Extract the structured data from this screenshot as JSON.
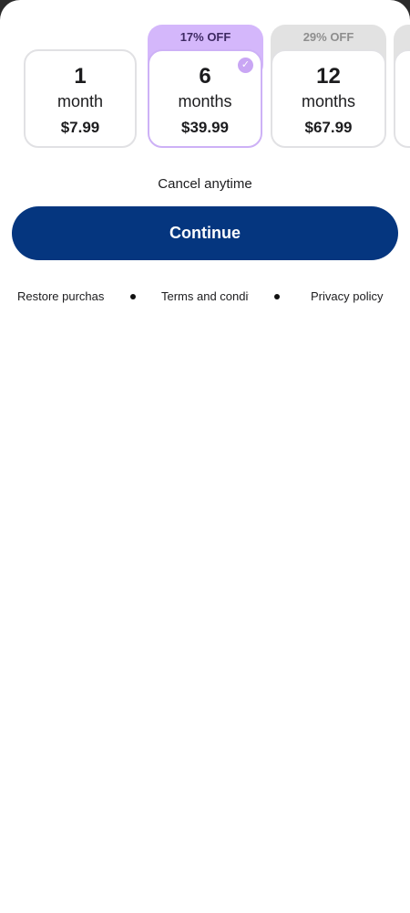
{
  "plans": [
    {
      "number": "1",
      "unit": "month",
      "price": "$7.99",
      "badge": ""
    },
    {
      "number": "6",
      "unit": "months",
      "price": "$39.99",
      "badge": "17% OFF",
      "selected": true
    },
    {
      "number": "12",
      "unit": "months",
      "price": "$67.99",
      "badge": "29% OFF"
    }
  ],
  "cancel_text": "Cancel anytime",
  "continue_label": "Continue",
  "footer": {
    "restore": "Restore purchases",
    "terms": "Terms and conditions",
    "privacy": "Privacy policy"
  },
  "colors": {
    "primary": "#05367f",
    "selected_accent": "#d4b7fb",
    "discount_gray": "#e2e2e2"
  },
  "icons": {
    "selected_check": "check-icon"
  }
}
